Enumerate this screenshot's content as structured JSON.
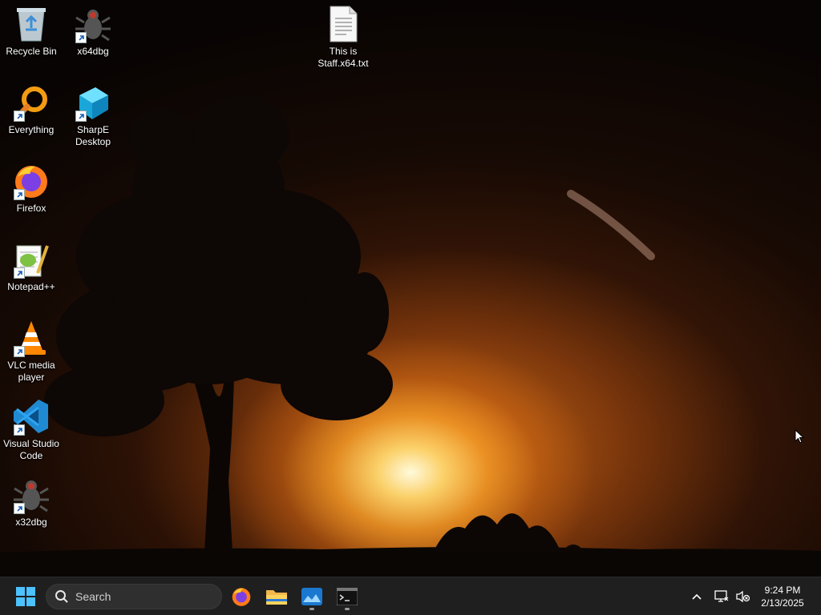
{
  "desktop": {
    "icons": [
      {
        "id": "recycle-bin",
        "label": "Recycle Bin",
        "icon": "recycle-bin-icon",
        "shortcut": false
      },
      {
        "id": "x64dbg",
        "label": "x64dbg",
        "icon": "x64dbg-bug-icon",
        "shortcut": true
      },
      {
        "id": "txt-file",
        "label": "This is Staff.x64.txt",
        "icon": "text-file-icon",
        "shortcut": false
      },
      {
        "id": "everything",
        "label": "Everything",
        "icon": "everything-magnifier-icon",
        "shortcut": true
      },
      {
        "id": "sharpe",
        "label": "SharpE Desktop",
        "icon": "sharpe-cube-icon",
        "shortcut": true
      },
      {
        "id": "firefox",
        "label": "Firefox",
        "icon": "firefox-icon",
        "shortcut": true
      },
      {
        "id": "notepadpp",
        "label": "Notepad++",
        "icon": "notepadpp-icon",
        "shortcut": true
      },
      {
        "id": "vlc",
        "label": "VLC media player",
        "icon": "vlc-cone-icon",
        "shortcut": true
      },
      {
        "id": "vscode",
        "label": "Visual Studio Code",
        "icon": "vscode-icon",
        "shortcut": true
      },
      {
        "id": "x32dbg",
        "label": "x32dbg",
        "icon": "x32dbg-bug-icon",
        "shortcut": true
      }
    ]
  },
  "taskbar": {
    "start_icon": "windows-start-icon",
    "search_placeholder": "Search",
    "pinned": [
      {
        "name": "Firefox",
        "icon": "firefox-icon",
        "running": false
      },
      {
        "name": "File Explorer",
        "icon": "folder-icon",
        "running": false
      },
      {
        "name": "Image viewer",
        "icon": "image-app-icon",
        "running": true
      },
      {
        "name": "Terminal",
        "icon": "terminal-icon",
        "running": true
      }
    ],
    "tray": {
      "overflow_icon": "chevron-up-icon",
      "network_icon": "network-icon",
      "volume_icon": "volume-muted-icon"
    },
    "clock": {
      "time": "9:24 PM",
      "date": "2/13/2025"
    }
  },
  "colors": {
    "taskbar_bg": "#1f1f1f",
    "sun": "#ffd56e",
    "accent_blue": "#0078d4"
  }
}
